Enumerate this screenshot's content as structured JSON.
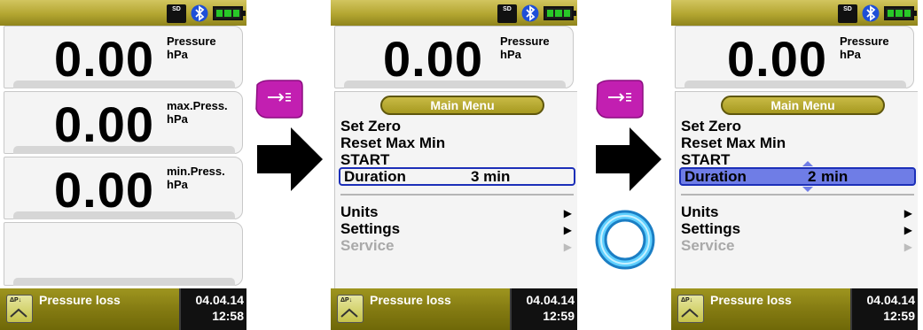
{
  "screens": [
    {
      "status_icons": {
        "sd": "SD",
        "bluetooth": "bluetooth-icon",
        "battery": "battery-full-icon"
      },
      "readings": [
        {
          "value": "0.00",
          "label": "Pressure",
          "unit": "hPa"
        },
        {
          "value": "0.00",
          "label": "max.Press.",
          "unit": "hPa"
        },
        {
          "value": "0.00",
          "label": "min.Press.",
          "unit": "hPa"
        }
      ],
      "mode_icon_text": "ΔP↓",
      "mode_label": "Pressure loss",
      "date": "04.04.14",
      "time": "12:58"
    },
    {
      "status_icons": {
        "sd": "SD",
        "bluetooth": "bluetooth-icon",
        "battery": "battery-full-icon"
      },
      "reading": {
        "value": "0.00",
        "label": "Pressure",
        "unit": "hPa"
      },
      "menu": {
        "title": "Main Menu",
        "items": [
          "Set Zero",
          "Reset Max Min",
          "START"
        ],
        "duration_label": "Duration",
        "duration_value": "3 min",
        "submenus": [
          "Units",
          "Settings",
          "Service"
        ]
      },
      "mode_icon_text": "ΔP↓",
      "mode_label": "Pressure loss",
      "date": "04.04.14",
      "time": "12:59"
    },
    {
      "status_icons": {
        "sd": "SD",
        "bluetooth": "bluetooth-icon",
        "battery": "battery-full-icon"
      },
      "reading": {
        "value": "0.00",
        "label": "Pressure",
        "unit": "hPa"
      },
      "menu": {
        "title": "Main Menu",
        "items": [
          "Set Zero",
          "Reset Max Min",
          "START"
        ],
        "duration_label": "Duration",
        "duration_number": "2",
        "duration_unit": "min",
        "submenus": [
          "Units",
          "Settings",
          "Service"
        ]
      },
      "mode_icon_text": "ΔP↓",
      "mode_label": "Pressure loss",
      "date": "04.04.14",
      "time": "12:59"
    }
  ],
  "colors": {
    "accent_gold": "#b3a631",
    "selection_blue": "#1c2fb8",
    "edit_fill": "#6f7de6",
    "key_magenta": "#c21fb1",
    "ring_blue": "#2aa6e6",
    "disabled": "#a9a9a9"
  },
  "between_icons": [
    "menu-key-icon",
    "right-arrow-icon",
    "menu-key-icon",
    "right-arrow-icon",
    "rotary-ring-icon"
  ]
}
